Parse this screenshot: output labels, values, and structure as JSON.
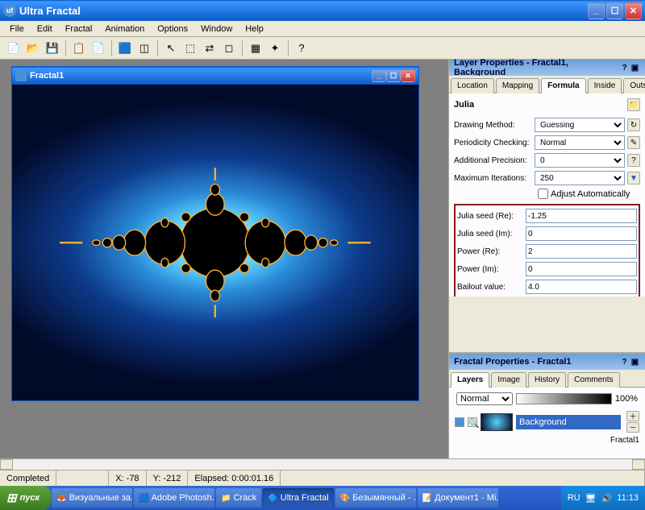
{
  "app": {
    "title": "Ultra Fractal"
  },
  "menu": [
    "File",
    "Edit",
    "Fractal",
    "Animation",
    "Options",
    "Window",
    "Help"
  ],
  "doc": {
    "title": "Fractal1"
  },
  "layer_props": {
    "header": "Layer Properties - Fractal1, Background",
    "tabs": [
      "Location",
      "Mapping",
      "Formula",
      "Inside",
      "Outside"
    ],
    "active_tab": "Formula",
    "formula_name": "Julia",
    "drawing_method": {
      "label": "Drawing Method:",
      "value": "Guessing"
    },
    "periodicity": {
      "label": "Periodicity Checking:",
      "value": "Normal"
    },
    "precision": {
      "label": "Additional Precision:",
      "value": "0"
    },
    "max_iter": {
      "label": "Maximum Iterations:",
      "value": "250"
    },
    "adjust_auto": "Adjust Automatically",
    "params": {
      "seed_re": {
        "label": "Julia seed (Re):",
        "value": "-1.25"
      },
      "seed_im": {
        "label": "Julia seed (Im):",
        "value": "0"
      },
      "power_re": {
        "label": "Power (Re):",
        "value": "2"
      },
      "power_im": {
        "label": "Power (Im):",
        "value": "0"
      },
      "bailout": {
        "label": "Bailout value:",
        "value": "4.0"
      }
    }
  },
  "fractal_props": {
    "header": "Fractal Properties - Fractal1",
    "tabs": [
      "Layers",
      "Image",
      "History",
      "Comments"
    ],
    "blend_mode": "Normal",
    "opacity": "100%",
    "layer_name": "Background"
  },
  "status": {
    "completed": "Completed",
    "x": "X: -78",
    "y": "Y: -212",
    "elapsed": "Elapsed: 0:00:01.16"
  },
  "taskbar": {
    "start": "пуск",
    "items": [
      "Визуальные за...",
      "Adobe Photosh...",
      "Crack",
      "Ultra Fractal",
      "Безымянный - ...",
      "Документ1 - Mi..."
    ],
    "active_index": 3,
    "lang": "RU",
    "time": "11:13"
  }
}
